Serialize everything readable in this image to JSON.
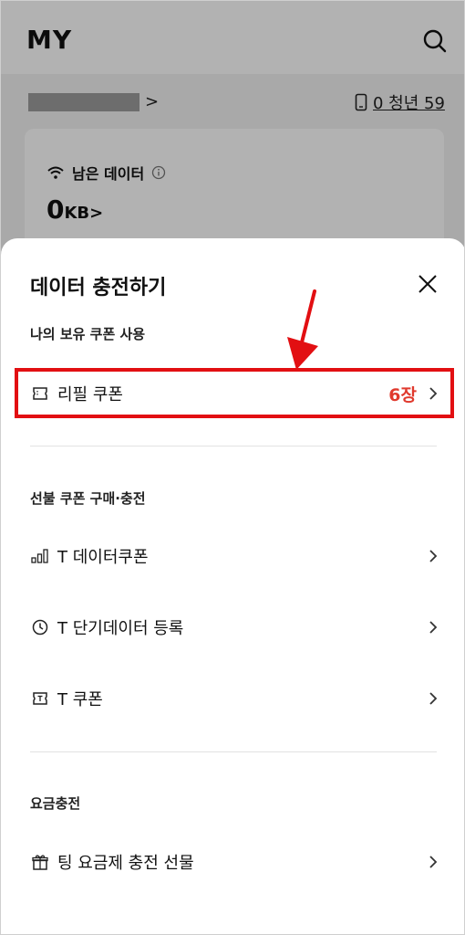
{
  "background": {
    "title": "MY",
    "chevron": ">",
    "plan_text": "0 청년 59",
    "data_label": "남은 데이터",
    "data_value": "0",
    "data_unit": "KB",
    "data_chevron": ">"
  },
  "sheet": {
    "title": "데이터 충전하기",
    "sections": [
      {
        "heading": "나의 보유 쿠폰 사용",
        "items": [
          {
            "label": "리필 쿠폰",
            "count": "6장",
            "icon": "coupon-icon"
          }
        ]
      },
      {
        "heading": "선불 쿠폰 구매·충전",
        "items": [
          {
            "label": "T 데이터쿠폰",
            "icon": "signal-bars-icon"
          },
          {
            "label": "T 단기데이터 등록",
            "icon": "clock-icon"
          },
          {
            "label": "T 쿠폰",
            "icon": "t-coupon-icon"
          }
        ]
      },
      {
        "heading": "요금충전",
        "items": [
          {
            "label": "팅 요금제 충전 선물",
            "icon": "gift-icon"
          }
        ]
      }
    ]
  },
  "colors": {
    "highlight": "#e20f12",
    "count": "#e03a2e",
    "arrow": "#e20f12"
  }
}
